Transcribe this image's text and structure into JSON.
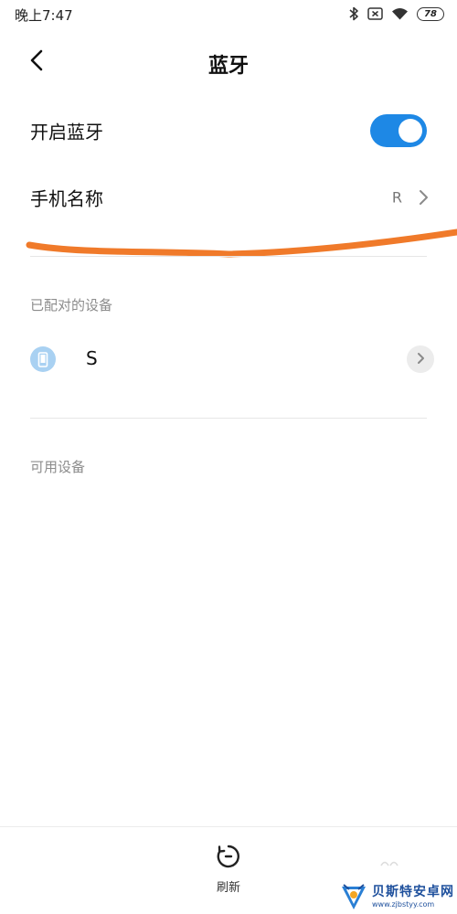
{
  "status_bar": {
    "time": "晚上7:47",
    "battery": "78",
    "icons": [
      "bluetooth-icon",
      "sim-off-icon",
      "wifi-icon",
      "battery-icon"
    ]
  },
  "header": {
    "title": "蓝牙",
    "back_icon": "chevron-left-icon"
  },
  "settings": {
    "bluetooth_toggle_label": "开启蓝牙",
    "bluetooth_enabled": true,
    "device_name_label": "手机名称",
    "device_name_value": "R"
  },
  "paired": {
    "header": "已配对的设备",
    "devices": [
      {
        "name": "S",
        "icon": "phone-icon"
      }
    ]
  },
  "available": {
    "header": "可用设备"
  },
  "bottom_bar": {
    "refresh_label": "刷新"
  },
  "watermark": {
    "name": "贝斯特安卓网",
    "url": "www.zjbstyy.com"
  },
  "colors": {
    "accent": "#1e88e5",
    "annotation_stroke": "#f07a2a",
    "section_header": "#8c8c8c",
    "device_icon_bg": "#a9d1f2"
  }
}
